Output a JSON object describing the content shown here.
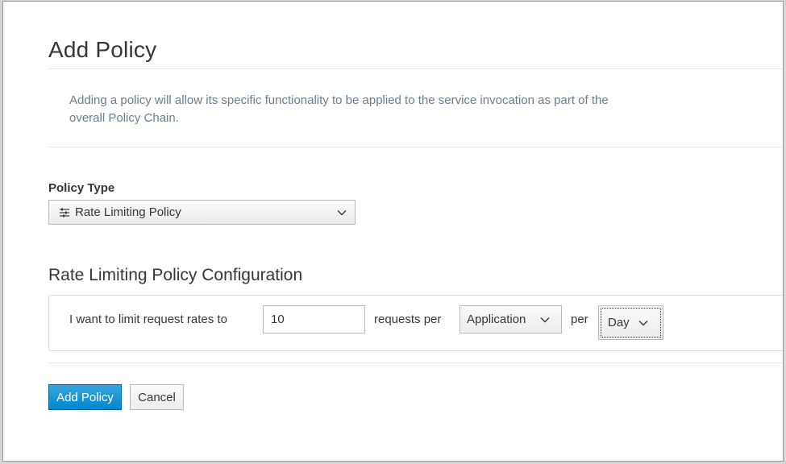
{
  "dialog": {
    "title": "Add Policy",
    "description": "Adding a policy will allow its specific functionality to be applied to the service invocation as part of the overall Policy Chain."
  },
  "policy_type": {
    "label": "Policy Type",
    "selected": "Rate Limiting Policy",
    "icon": "sliders-icon"
  },
  "config": {
    "title": "Rate Limiting Policy Configuration",
    "prefix_text": "I want to limit request rates to",
    "limit_value": "10",
    "requests_per_text": "requests per",
    "granularity": "Application",
    "per_text": "per",
    "period": "Day"
  },
  "buttons": {
    "add_policy": "Add Policy",
    "cancel": "Cancel"
  },
  "colors": {
    "primary": "#0088ce",
    "description_text": "#6a7d8e"
  }
}
